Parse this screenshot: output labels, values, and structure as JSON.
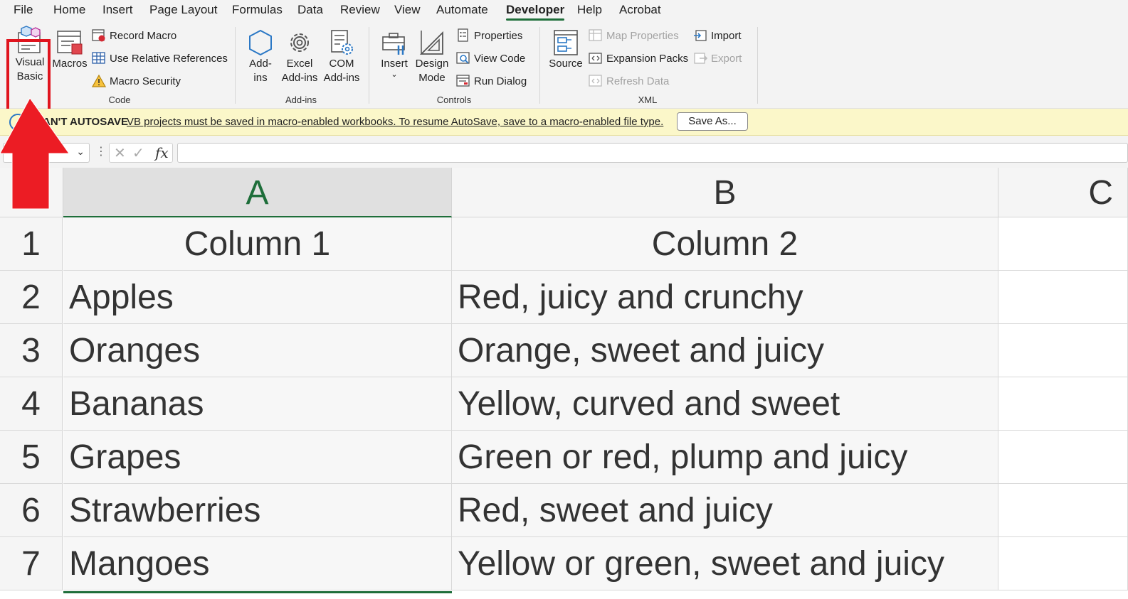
{
  "menu": {
    "tabs": [
      {
        "label": "File"
      },
      {
        "label": "Home"
      },
      {
        "label": "Insert"
      },
      {
        "label": "Page Layout"
      },
      {
        "label": "Formulas"
      },
      {
        "label": "Data"
      },
      {
        "label": "Review"
      },
      {
        "label": "View"
      },
      {
        "label": "Automate"
      },
      {
        "label": "Developer",
        "active": true
      },
      {
        "label": "Help"
      },
      {
        "label": "Acrobat"
      }
    ]
  },
  "ribbon": {
    "code": {
      "label": "Code",
      "visual_basic": "Visual\nBasic",
      "macros": "Macros",
      "record_macro": "Record Macro",
      "use_relative": "Use Relative References",
      "macro_security": "Macro Security"
    },
    "addins": {
      "label": "Add-ins",
      "addins": "Add-\nins",
      "excel_addins": "Excel\nAdd-ins",
      "com_addins": "COM\nAdd-ins"
    },
    "controls": {
      "label": "Controls",
      "insert": "Insert",
      "design_mode": "Design\nMode",
      "properties": "Properties",
      "view_code": "View Code",
      "run_dialog": "Run Dialog"
    },
    "xml": {
      "label": "XML",
      "source": "Source",
      "map_properties": "Map Properties",
      "expansion_packs": "Expansion Packs",
      "refresh_data": "Refresh Data",
      "import": "Import",
      "export": "Export"
    }
  },
  "message_bar": {
    "title": "AN'T AUTOSAVE",
    "text": "VB projects must be saved in macro-enabled workbooks. To resume AutoSave, save to a macro-enabled file type.",
    "button": "Save As..."
  },
  "formula_bar": {
    "fx": "fx",
    "value": ""
  },
  "sheet": {
    "columns": [
      "A",
      "B",
      "C"
    ],
    "rows": [
      {
        "num": "1",
        "a": "Column 1",
        "b": "Column 2"
      },
      {
        "num": "2",
        "a": "Apples",
        "b": "Red, juicy and crunchy"
      },
      {
        "num": "3",
        "a": "Oranges",
        "b": "Orange, sweet and juicy"
      },
      {
        "num": "4",
        "a": "Bananas",
        "b": "Yellow, curved and sweet"
      },
      {
        "num": "5",
        "a": "Grapes",
        "b": "Green or red, plump and juicy"
      },
      {
        "num": "6",
        "a": "Strawberries",
        "b": "Red, sweet and juicy"
      },
      {
        "num": "7",
        "a": "Mangoes",
        "b": "Yellow or green, sweet and juicy"
      }
    ]
  },
  "colors": {
    "accent_green": "#1e6e3a",
    "annotation_red": "#e0141e",
    "message_bar": "#fbf7c9"
  }
}
